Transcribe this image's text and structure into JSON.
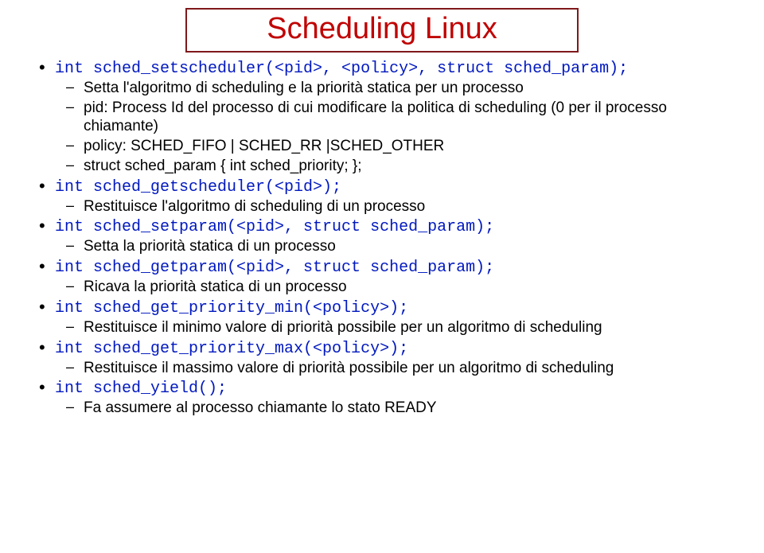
{
  "title": "Scheduling Linux",
  "items": [
    {
      "code": "int sched_setscheduler(<pid>, <policy>, struct sched_param);",
      "sub": [
        "Setta l'algoritmo di scheduling e la priorità statica per un processo",
        "pid: Process Id del processo di cui modificare la politica di scheduling (0 per il processo chiamante)",
        "policy: SCHED_FIFO | SCHED_RR |SCHED_OTHER",
        "struct sched_param { int sched_priority; };"
      ]
    },
    {
      "code": "int sched_getscheduler(<pid>);",
      "sub": [
        "Restituisce l'algoritmo di scheduling di un processo"
      ]
    },
    {
      "code": "int sched_setparam(<pid>, struct sched_param);",
      "sub": [
        "Setta la priorità statica di un processo"
      ]
    },
    {
      "code": "int sched_getparam(<pid>, struct sched_param);",
      "sub": [
        "Ricava la priorità statica di un processo"
      ]
    },
    {
      "code": "int sched_get_priority_min(<policy>);",
      "sub": [
        "Restituisce il minimo valore di priorità possibile per un algoritmo di scheduling"
      ]
    },
    {
      "code": "int sched_get_priority_max(<policy>);",
      "sub": [
        "Restituisce il massimo valore di priorità possibile per un algoritmo di scheduling"
      ]
    },
    {
      "code": "int sched_yield();",
      "sub": [
        "Fa assumere al processo chiamante lo stato READY"
      ]
    }
  ]
}
